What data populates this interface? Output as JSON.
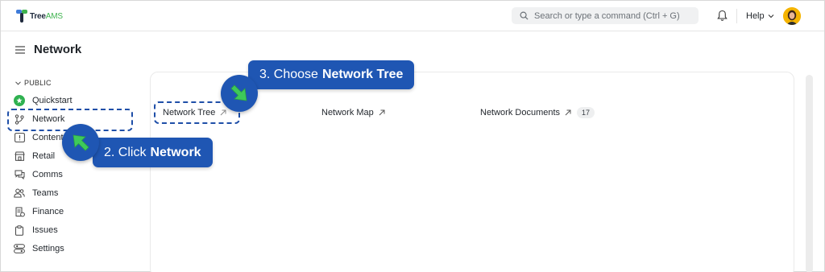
{
  "app": {
    "logo_tree": "Tree",
    "logo_ams": "AMS",
    "search_placeholder": "Search or type a command (Ctrl + G)",
    "help_label": "Help"
  },
  "page": {
    "title": "Network"
  },
  "sidebar": {
    "section_label": "PUBLIC",
    "items": [
      {
        "label": "Quickstart",
        "icon": "quickstart-icon"
      },
      {
        "label": "Network",
        "icon": "branch-icon"
      },
      {
        "label": "Content",
        "icon": "content-icon"
      },
      {
        "label": "Retail",
        "icon": "store-icon"
      },
      {
        "label": "Comms",
        "icon": "chat-icon"
      },
      {
        "label": "Teams",
        "icon": "users-icon"
      },
      {
        "label": "Finance",
        "icon": "finance-icon"
      },
      {
        "label": "Issues",
        "icon": "clipboard-icon"
      },
      {
        "label": "Settings",
        "icon": "settings-icon"
      }
    ]
  },
  "main": {
    "links": [
      {
        "label": "Network Tree"
      },
      {
        "label": "Network Map"
      },
      {
        "label": "Network Documents",
        "count": "17"
      }
    ]
  },
  "annotations": {
    "step2_prefix": "2. Click",
    "step2_bold": "Network",
    "step3_prefix": "3. Choose",
    "step3_bold": "Network Tree"
  },
  "colors": {
    "accent_blue": "#1f56b3",
    "pointer_green": "#3ec95a",
    "quickstart_green": "#2fb150",
    "brand_green": "#3fb34f"
  }
}
